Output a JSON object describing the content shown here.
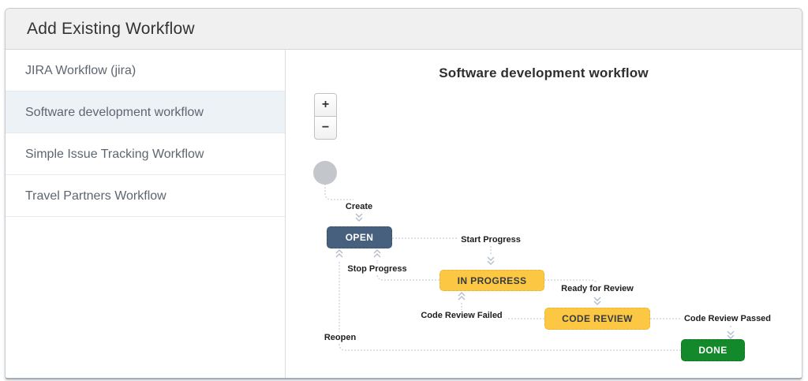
{
  "dialog": {
    "title": "Add Existing Workflow"
  },
  "sidebar": {
    "items": [
      {
        "label": "JIRA Workflow (jira)",
        "selected": false
      },
      {
        "label": "Software development workflow",
        "selected": true
      },
      {
        "label": "Simple Issue Tracking Workflow",
        "selected": false
      },
      {
        "label": "Travel Partners Workflow",
        "selected": false
      }
    ]
  },
  "preview": {
    "title": "Software development workflow",
    "zoom_in_label": "+",
    "zoom_out_label": "−",
    "diagram": {
      "type": "workflow",
      "start_node": "gray-circle",
      "statuses": [
        {
          "label": "OPEN",
          "color": "#46607d",
          "text_color": "#ffffff"
        },
        {
          "label": "IN PROGRESS",
          "color": "#fcc742",
          "text_color": "#343b44"
        },
        {
          "label": "CODE REVIEW",
          "color": "#fcc742",
          "text_color": "#343b44"
        },
        {
          "label": "DONE",
          "color": "#14892c",
          "text_color": "#ffffff"
        }
      ],
      "transitions": [
        {
          "label": "Create",
          "from": "start",
          "to": "OPEN"
        },
        {
          "label": "Start Progress",
          "from": "OPEN",
          "to": "IN PROGRESS"
        },
        {
          "label": "Stop Progress",
          "from": "IN PROGRESS",
          "to": "OPEN"
        },
        {
          "label": "Ready for Review",
          "from": "IN PROGRESS",
          "to": "CODE REVIEW"
        },
        {
          "label": "Code Review Failed",
          "from": "CODE REVIEW",
          "to": "IN PROGRESS"
        },
        {
          "label": "Code Review Passed",
          "from": "CODE REVIEW",
          "to": "DONE"
        },
        {
          "label": "Reopen",
          "from": "DONE",
          "to": "OPEN"
        }
      ],
      "line_color": "#c9d0da",
      "arrow_color": "#b4bdca",
      "start_circle_color": "#c3c6ca"
    }
  }
}
